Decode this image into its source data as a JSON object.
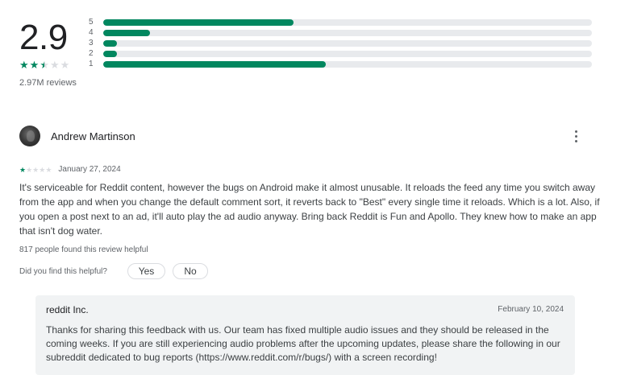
{
  "summary": {
    "average": "2.9",
    "stars_value": 2.5,
    "review_count": "2.97M reviews",
    "bars": [
      {
        "label": "5",
        "fraction": 0.39
      },
      {
        "label": "4",
        "fraction": 0.095
      },
      {
        "label": "3",
        "fraction": 0.028
      },
      {
        "label": "2",
        "fraction": 0.028
      },
      {
        "label": "1",
        "fraction": 0.455
      }
    ]
  },
  "review": {
    "author": "Andrew Martinson",
    "stars_value": 1,
    "date": "January 27, 2024",
    "text": "It's serviceable for Reddit content, however the bugs on Android make it almost unusable. It reloads the feed any time you switch away from the app and when you change the default comment sort, it reverts back to \"Best\" every single time it reloads. Which is a lot. Also, if you open a post next to an ad, it'll auto play the ad audio anyway. Bring back Reddit is Fun and Apollo. They knew how to make an app that isn't dog water.",
    "helpful_count": "817 people found this review helpful",
    "helpful_question": "Did you find this helpful?",
    "yes_label": "Yes",
    "no_label": "No"
  },
  "reply": {
    "developer": "reddit Inc.",
    "date": "February 10, 2024",
    "text": "Thanks for sharing this feedback with us. Our team has fixed multiple audio issues and they should be released in the coming weeks. If you are still experiencing audio problems after the upcoming updates, please share the following in our subreddit dedicated to bug reports (https://www.reddit.com/r/bugs/) with a screen recording!"
  },
  "colors": {
    "accent": "#01875f",
    "track": "#e8eaed",
    "reply_bg": "#f1f3f4"
  },
  "icons": {
    "star": "star-icon",
    "more": "more-vert-icon",
    "avatar": "avatar-image"
  }
}
